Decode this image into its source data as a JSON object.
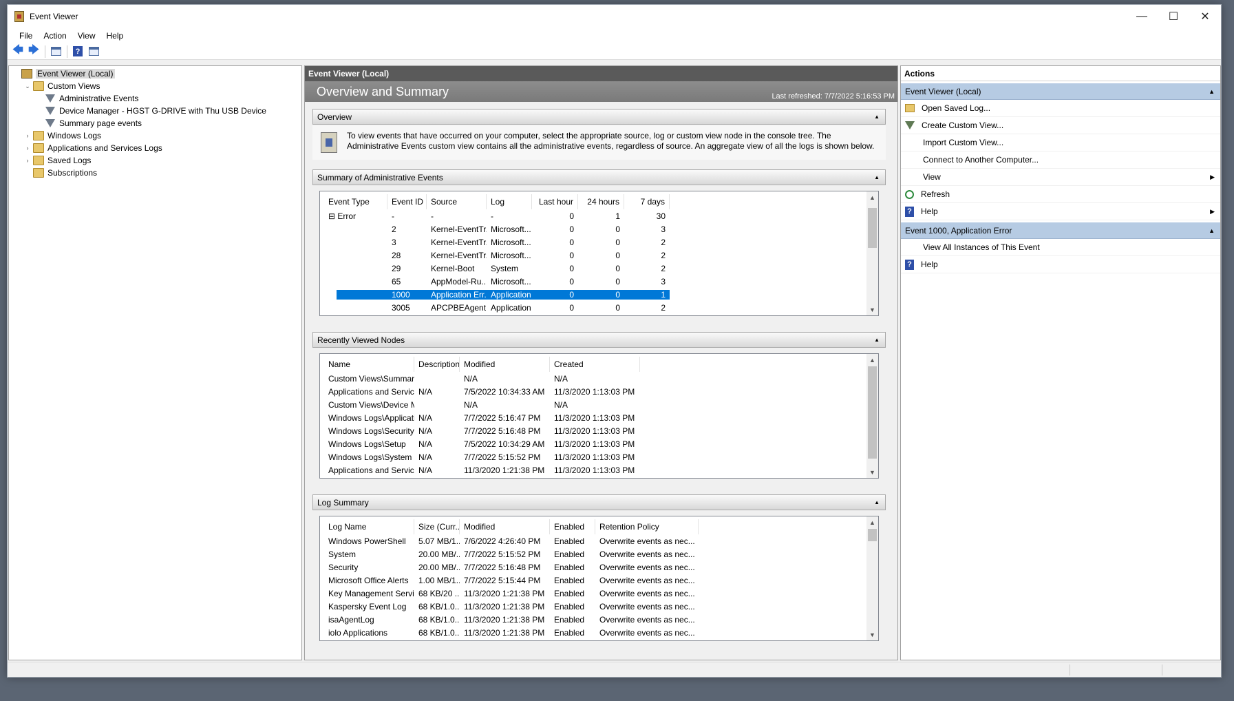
{
  "window": {
    "title": "Event Viewer",
    "controls": {
      "minimize": "—",
      "maximize": "☐",
      "close": "✕"
    }
  },
  "menu": [
    "File",
    "Action",
    "View",
    "Help"
  ],
  "toolbar": {
    "back": "🡄",
    "forward": "🡆",
    "help": "?"
  },
  "tree": [
    {
      "label": "Event Viewer (Local)",
      "level": 0,
      "icon": "event-viewer-icon",
      "expander": "",
      "selected": true
    },
    {
      "label": "Custom Views",
      "level": 1,
      "icon": "folder-icon",
      "expander": "⌄"
    },
    {
      "label": "Administrative Events",
      "level": 2,
      "icon": "filter-icon",
      "expander": ""
    },
    {
      "label": "Device Manager - HGST G-DRIVE with Thu USB Device",
      "level": 2,
      "icon": "filter-icon",
      "expander": ""
    },
    {
      "label": "Summary page events",
      "level": 2,
      "icon": "filter-icon",
      "expander": ""
    },
    {
      "label": "Windows Logs",
      "level": 1,
      "icon": "folder-icon",
      "expander": "›"
    },
    {
      "label": "Applications and Services Logs",
      "level": 1,
      "icon": "folder-icon",
      "expander": "›"
    },
    {
      "label": "Saved Logs",
      "level": 1,
      "icon": "folder-icon",
      "expander": "›"
    },
    {
      "label": "Subscriptions",
      "level": 1,
      "icon": "folder-icon",
      "expander": ""
    }
  ],
  "center": {
    "header": "Event Viewer (Local)",
    "title": "Overview and Summary",
    "last_refreshed": "Last refreshed: 7/7/2022 5:16:53 PM",
    "overview": {
      "label": "Overview",
      "text": "To view events that have occurred on your computer, select the appropriate source, log or custom view node in the console tree. The Administrative Events custom view contains all the administrative events, regardless of source. An aggregate view of all the logs is shown below."
    },
    "summary": {
      "label": "Summary of Administrative Events",
      "columns": [
        "Event Type",
        "Event ID",
        "Source",
        "Log",
        "Last hour",
        "24 hours",
        "7 days"
      ],
      "rows": [
        [
          "Error",
          "-",
          "-",
          "-",
          "0",
          "1",
          "30"
        ],
        [
          "",
          "2",
          "Kernel-EventTr...",
          "Microsoft...",
          "0",
          "0",
          "3"
        ],
        [
          "",
          "3",
          "Kernel-EventTr...",
          "Microsoft...",
          "0",
          "0",
          "2"
        ],
        [
          "",
          "28",
          "Kernel-EventTr...",
          "Microsoft...",
          "0",
          "0",
          "2"
        ],
        [
          "",
          "29",
          "Kernel-Boot",
          "System",
          "0",
          "0",
          "2"
        ],
        [
          "",
          "65",
          "AppModel-Ru...",
          "Microsoft...",
          "0",
          "0",
          "3"
        ],
        [
          "",
          "1000",
          "Application Err...",
          "Application",
          "0",
          "0",
          "1"
        ],
        [
          "",
          "3005",
          "APCPBEAgent",
          "Application",
          "0",
          "0",
          "2"
        ]
      ],
      "group_toggle": "⊟"
    },
    "recent": {
      "label": "Recently Viewed Nodes",
      "columns": [
        "Name",
        "Description",
        "Modified",
        "Created"
      ],
      "rows": [
        [
          "Custom Views\\Summary...",
          "",
          "N/A",
          "N/A"
        ],
        [
          "Applications and Service...",
          "N/A",
          "7/5/2022 10:34:33 AM",
          "11/3/2020 1:13:03 PM"
        ],
        [
          "Custom Views\\Device M...",
          "",
          "N/A",
          "N/A"
        ],
        [
          "Windows Logs\\Applicati...",
          "N/A",
          "7/7/2022 5:16:47 PM",
          "11/3/2020 1:13:03 PM"
        ],
        [
          "Windows Logs\\Security",
          "N/A",
          "7/7/2022 5:16:48 PM",
          "11/3/2020 1:13:03 PM"
        ],
        [
          "Windows Logs\\Setup",
          "N/A",
          "7/5/2022 10:34:29 AM",
          "11/3/2020 1:13:03 PM"
        ],
        [
          "Windows Logs\\System",
          "N/A",
          "7/7/2022 5:15:52 PM",
          "11/3/2020 1:13:03 PM"
        ],
        [
          "Applications and Service...",
          "N/A",
          "11/3/2020 1:21:38 PM",
          "11/3/2020 1:13:03 PM"
        ]
      ]
    },
    "logsummary": {
      "label": "Log Summary",
      "columns": [
        "Log Name",
        "Size (Curr...",
        "Modified",
        "Enabled",
        "Retention Policy"
      ],
      "rows": [
        [
          "Windows PowerShell",
          "5.07 MB/1...",
          "7/6/2022 4:26:40 PM",
          "Enabled",
          "Overwrite events as nec..."
        ],
        [
          "System",
          "20.00 MB/...",
          "7/7/2022 5:15:52 PM",
          "Enabled",
          "Overwrite events as nec..."
        ],
        [
          "Security",
          "20.00 MB/...",
          "7/7/2022 5:16:48 PM",
          "Enabled",
          "Overwrite events as nec..."
        ],
        [
          "Microsoft Office Alerts",
          "1.00 MB/1...",
          "7/7/2022 5:15:44 PM",
          "Enabled",
          "Overwrite events as nec..."
        ],
        [
          "Key Management Service",
          "68 KB/20 ...",
          "11/3/2020 1:21:38 PM",
          "Enabled",
          "Overwrite events as nec..."
        ],
        [
          "Kaspersky Event Log",
          "68 KB/1.0...",
          "11/3/2020 1:21:38 PM",
          "Enabled",
          "Overwrite events as nec..."
        ],
        [
          "isaAgentLog",
          "68 KB/1.0...",
          "11/3/2020 1:21:38 PM",
          "Enabled",
          "Overwrite events as nec..."
        ],
        [
          "iolo Applications",
          "68 KB/1.0...",
          "11/3/2020 1:21:38 PM",
          "Enabled",
          "Overwrite events as nec..."
        ]
      ]
    },
    "collapse_glyph": "▲",
    "scroll": {
      "up": "▲",
      "down": "▼"
    }
  },
  "actions": {
    "title": "Actions",
    "groups": [
      {
        "label": "Event Viewer (Local)",
        "caret": "▲",
        "items": [
          {
            "label": "Open Saved Log...",
            "icon": "folder-open-icon",
            "sub": ""
          },
          {
            "label": "Create Custom View...",
            "icon": "filter-icon",
            "sub": ""
          },
          {
            "label": "Import Custom View...",
            "icon": "",
            "sub": ""
          },
          {
            "label": "Connect to Another Computer...",
            "icon": "",
            "sub": ""
          },
          {
            "label": "View",
            "icon": "",
            "sub": "▶"
          },
          {
            "label": "Refresh",
            "icon": "refresh-icon",
            "sub": ""
          },
          {
            "label": "Help",
            "icon": "help-icon",
            "sub": "▶"
          }
        ]
      },
      {
        "label": "Event 1000, Application Error",
        "caret": "▲",
        "items": [
          {
            "label": "View All Instances of This Event",
            "icon": "",
            "sub": ""
          },
          {
            "label": "Help",
            "icon": "help-icon",
            "sub": ""
          }
        ]
      }
    ]
  },
  "colors": {
    "selection": "#0078d7",
    "action_group": "#b6cbe3",
    "center_header": "#5a5a5a"
  }
}
